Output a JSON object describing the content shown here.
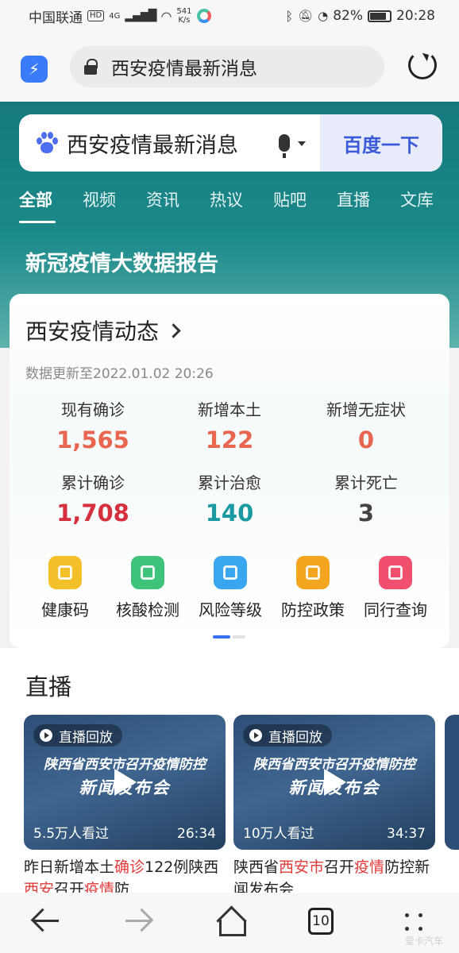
{
  "status_bar": {
    "carrier": "中国联通",
    "hd": "HD",
    "network": "4G",
    "speed_value": "541",
    "speed_unit": "K/s",
    "battery": "82%",
    "battery_level": 0.82,
    "time": "20:28"
  },
  "address_bar": {
    "url_text": "西安疫情最新消息"
  },
  "search": {
    "query": "西安疫情最新消息",
    "button_label": "百度一下"
  },
  "tabs": [
    "全部",
    "视频",
    "资讯",
    "热议",
    "贴吧",
    "直播",
    "文库"
  ],
  "report_title": "新冠疫情大数据报告",
  "card": {
    "title": "西安疫情动态",
    "updated": "数据更新至2022.01.02 20:26",
    "stats": [
      {
        "label": "现有确诊",
        "value": "1,565",
        "color": "#e8664f"
      },
      {
        "label": "新增本土",
        "value": "122",
        "color": "#e8664f"
      },
      {
        "label": "新增无症状",
        "value": "0",
        "color": "#e8664f"
      },
      {
        "label": "累计确诊",
        "value": "1,708",
        "color": "#d6303f"
      },
      {
        "label": "累计治愈",
        "value": "140",
        "color": "#1a9aa0"
      },
      {
        "label": "累计死亡",
        "value": "3",
        "color": "#444444"
      }
    ],
    "services": [
      {
        "label": "健康码",
        "icon": "qr-heart-icon",
        "color": "#f4c02a"
      },
      {
        "label": "核酸检测",
        "icon": "flask-icon",
        "color": "#3fc27a"
      },
      {
        "label": "风险等级",
        "icon": "siren-icon",
        "color": "#3ba6f0"
      },
      {
        "label": "防控政策",
        "icon": "book-icon",
        "color": "#f3a51f"
      },
      {
        "label": "同行查询",
        "icon": "person-icon",
        "color": "#f0506e"
      }
    ]
  },
  "live": {
    "title": "直播",
    "videos": [
      {
        "badge": "直播回放",
        "headline": "陕西省西安市召开疫情防控",
        "subline": "新闻发布会",
        "views": "5.5万人看过",
        "duration": "26:34",
        "caption_parts": [
          "昨日新增本土",
          "确诊",
          "122例",
          "陕西",
          "西安",
          "召开",
          "疫情",
          "防"
        ]
      },
      {
        "badge": "直播回放",
        "headline": "陕西省西安市召开疫情防控",
        "subline": "新闻发布会",
        "views": "10万人看过",
        "duration": "34:37",
        "caption_parts": [
          "陕西省",
          "西安市",
          "召开",
          "疫情",
          "防控新闻发布会"
        ]
      }
    ]
  },
  "bottom_bar": {
    "tab_count": "10"
  },
  "watermark": "爱卡汽车"
}
